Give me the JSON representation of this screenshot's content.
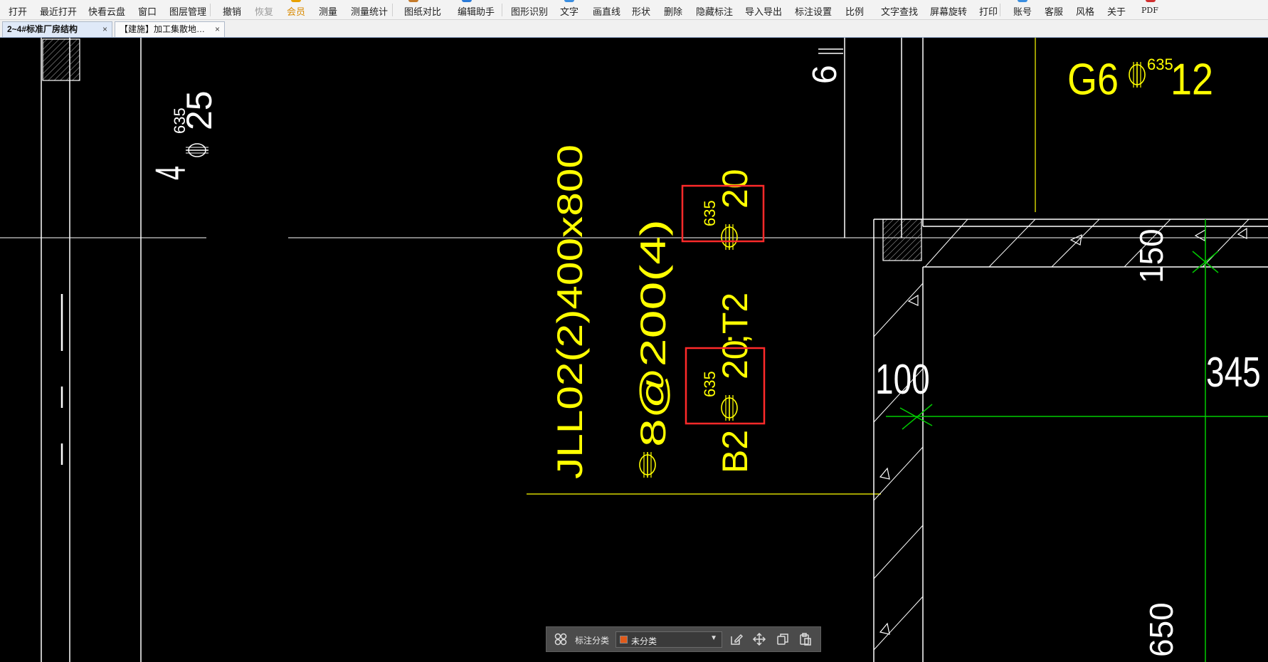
{
  "menu": {
    "items": [
      "打开",
      "最近打开",
      "快看云盘",
      "窗口",
      "图层管理",
      "撤销",
      "恢复",
      "会员",
      "测量",
      "测量统计",
      "图纸对比",
      "编辑助手",
      "图形识别",
      "文字",
      "画直线",
      "形状",
      "删除",
      "隐藏标注",
      "导入导出",
      "标注设置",
      "比例",
      "文字查找",
      "屏幕旋转",
      "打印",
      "账号",
      "客服",
      "风格",
      "关于",
      "PDF"
    ]
  },
  "tabs": [
    {
      "label": "2~4#标准厂房结构",
      "close": "×"
    },
    {
      "label": "【建施】加工集散地…",
      "close": "×"
    }
  ],
  "drawing": {
    "text_4phi25_a": "4",
    "text_4phi25_b": "25",
    "grade_sup": "635",
    "text_6_top": "6",
    "text_G6": "G6",
    "text_G6_num": "12",
    "beam_name": "JLL02(2)400x800",
    "stirrup": "8@200(4)",
    "text_B2": "B2",
    "text_20_b": "20",
    "text_T2": ";T2",
    "text_20_t": "20",
    "dim_100": "100",
    "dim_150_top": "150",
    "dim_345": "345",
    "dim_150_bottom": "650"
  },
  "colors": {
    "canvas": "#000000",
    "yellow": "#ffff00",
    "green": "#00cc00",
    "highlight": "#ff2a2a"
  },
  "bottom_toolbar": {
    "category_label": "标注分类",
    "category_value": "未分类",
    "category_color": "#e05a1a",
    "icons": [
      "grid-icon",
      "edit-icon",
      "move-icon",
      "copy-icon",
      "paste-icon"
    ]
  }
}
